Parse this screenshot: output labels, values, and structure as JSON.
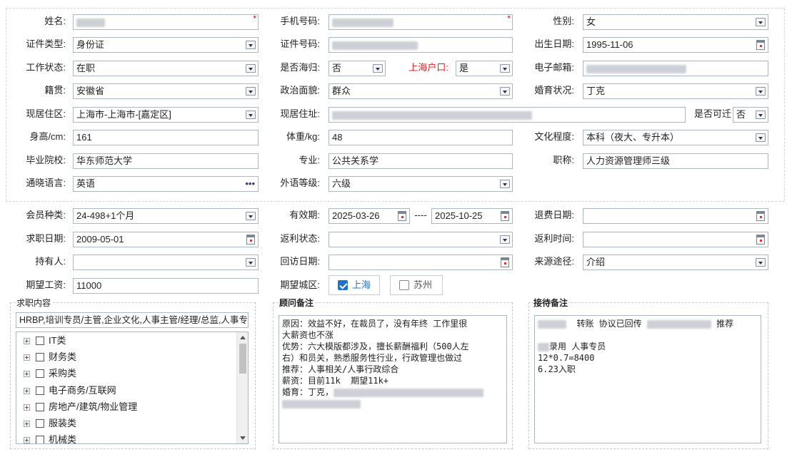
{
  "row1": {
    "name_label": "姓名:",
    "name_value": "",
    "phone_label": "手机号码:",
    "phone_value": "",
    "gender_label": "性别:",
    "gender_value": "女",
    "required_mark": "*"
  },
  "row2": {
    "idtype_label": "证件类型:",
    "idtype_value": "身份证",
    "idno_label": "证件号码:",
    "idno_value": "",
    "birth_label": "出生日期:",
    "birth_value": "1995-11-06"
  },
  "row3": {
    "work_label": "工作状态:",
    "work_value": "在职",
    "overseas_label": "是否海归:",
    "overseas_value": "否",
    "hukou_label": "上海户口:",
    "hukou_value": "是",
    "email_label": "电子邮箱:",
    "email_value": ""
  },
  "row4": {
    "native_label": "籍贯:",
    "native_value": "安徽省",
    "political_label": "政治面貌:",
    "political_value": "群众",
    "marital_label": "婚育状况:",
    "marital_value": "丁克"
  },
  "row5": {
    "residence_label": "现居住区:",
    "residence_value": "上海市-上海市-[嘉定区]",
    "address_label": "现居住址:",
    "address_value": "",
    "relocate_label": "是否可迁",
    "relocate_value": "否"
  },
  "row6": {
    "height_label": "身高/cm:",
    "height_value": "161",
    "weight_label": "体重/kg:",
    "weight_value": "48",
    "edu_label": "文化程度:",
    "edu_value": "本科（夜大、专升本）"
  },
  "row7": {
    "school_label": "毕业院校:",
    "school_value": "华东师范大学",
    "major_label": "专业:",
    "major_value": "公共关系学",
    "title_label": "职称:",
    "title_value": "人力资源管理师三级"
  },
  "row8": {
    "lang_label": "通晓语言:",
    "lang_value": "英语",
    "langlevel_label": "外语等级:",
    "langlevel_value": "六级"
  },
  "row9": {
    "member_label": "会员种类:",
    "member_value": "24-498+1个月",
    "valid_label": "有效期:",
    "valid_from": "2025-03-26",
    "valid_sep": "----",
    "valid_to": "2025-10-25",
    "refund_label": "退费日期:",
    "refund_value": ""
  },
  "row10": {
    "jobdate_label": "求职日期:",
    "jobdate_value": "2009-05-01",
    "rebate_label": "返利状态:",
    "rebate_value": "",
    "rebatetime_label": "返利时间:",
    "rebatetime_value": ""
  },
  "row11": {
    "holder_label": "持有人:",
    "holder_value": "",
    "visit_label": "回访日期:",
    "visit_value": "",
    "source_label": "来源途径:",
    "source_value": "介绍"
  },
  "row12": {
    "salary_label": "期望工资:",
    "salary_value": "11000",
    "city_label": "期望城区:",
    "city_options": [
      {
        "label": "上海",
        "checked": true
      },
      {
        "label": "苏州",
        "checked": false
      }
    ]
  },
  "job_content": {
    "title": "求职内容",
    "summary": "HRBP,培训专员/主管,企业文化,人事主管/经理/总监,人事专",
    "tree": [
      "IT类",
      "财务类",
      "采购类",
      "电子商务/互联网",
      "房地产/建筑/物业管理",
      "服装类",
      "机械类"
    ]
  },
  "consultant_note": {
    "title": "顾问备注",
    "lines": [
      "原因：效益不好，在裁员了，没有年终 工作里很",
      "大薪资也不涨",
      "优势：六大模版都涉及，擅长薪酬福利（500人左",
      "右）和员关，熟悉服务性行业，行政管理也做过",
      "推荐：人事相关/人事行政综合",
      "薪资：目前11k  期望11k+",
      "婚育：丁克，"
    ]
  },
  "reception_note": {
    "title": "接待备注",
    "line1_a": "转账 协议已回传",
    "line1_b": "推荐",
    "line2": "录用 人事专员",
    "line3": "12*0.7=8400",
    "line4": "6.23入职"
  }
}
